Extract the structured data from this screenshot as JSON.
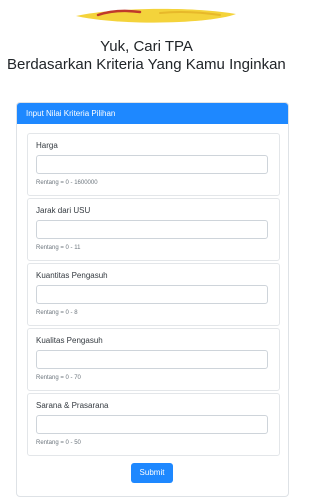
{
  "hero": {
    "line1": "Yuk, Cari TPA",
    "line2": "Berdasarkan Kriteria Yang Kamu Inginkan"
  },
  "form": {
    "header": "Input Nilai Kriteria Pilihan",
    "fields": [
      {
        "label": "Harga",
        "value": "",
        "hint": "Rentang = 0 - 1600000"
      },
      {
        "label": "Jarak dari USU",
        "value": "",
        "hint": "Rentang = 0 - 11"
      },
      {
        "label": "Kuantitas Pengasuh",
        "value": "",
        "hint": "Rentang = 0 - 8"
      },
      {
        "label": "Kualitas Pengasuh",
        "value": "",
        "hint": "Rentang = 0 - 70"
      },
      {
        "label": "Sarana & Prasarana",
        "value": "",
        "hint": "Rentang = 0 - 50"
      }
    ],
    "submit_label": "Submit"
  },
  "colors": {
    "primary": "#1e88ff",
    "logo_gold": "#f4d33b",
    "logo_red": "#c0392b"
  },
  "icons": {
    "logo": "brush-stroke-logo"
  }
}
